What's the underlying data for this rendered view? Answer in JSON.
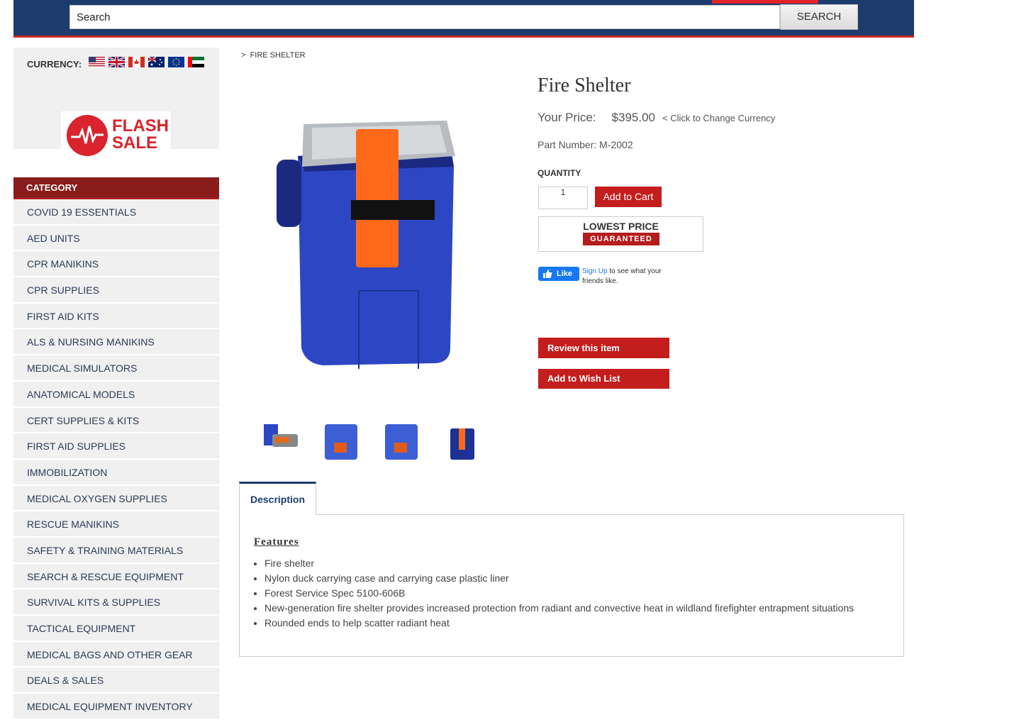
{
  "header": {
    "search_placeholder": "Search",
    "search_button": "SEARCH"
  },
  "sidebar": {
    "currency_label": "CURRENCY:",
    "currencies": [
      "us-flag-icon",
      "uk-flag-icon",
      "canada-flag-icon",
      "australia-flag-icon",
      "eu-flag-icon",
      "uae-flag-icon"
    ],
    "promo": {
      "line1": "FLASH",
      "line2": "SALE"
    },
    "category_title": "CATEGORY",
    "categories": [
      "COVID 19 ESSENTIALS",
      "AED UNITS",
      "CPR MANIKINS",
      "CPR SUPPLIES",
      "FIRST AID KITS",
      "ALS & NURSING MANIKINS",
      "MEDICAL SIMULATORS",
      "ANATOMICAL MODELS",
      "CERT SUPPLIES & KITS",
      "FIRST AID SUPPLIES",
      "IMMOBILIZATION",
      "MEDICAL OXYGEN SUPPLIES",
      "RESCUE MANIKINS",
      "SAFETY & TRAINING MATERIALS",
      "SEARCH & RESCUE EQUIPMENT",
      "SURVIVAL KITS & SUPPLIES",
      "TACTICAL EQUIPMENT",
      "MEDICAL BAGS AND OTHER GEAR",
      "DEALS & SALES",
      "MEDICAL EQUIPMENT INVENTORY"
    ]
  },
  "breadcrumb": {
    "sep": ">",
    "current": "FIRE SHELTER"
  },
  "product": {
    "title": "Fire Shelter",
    "price_label": "Your Price:",
    "price": "$395.00",
    "change_currency": "< Click to Change Currency",
    "part_label": "Part Number:",
    "part_number": "M-2002",
    "quantity_label": "QUANTITY",
    "quantity_value": "1",
    "add_to_cart": "Add to Cart",
    "lowest_price": "LOWEST PRICE",
    "guaranteed": "GUARANTEED",
    "like_label": "Like",
    "like_signup": "Sign Up",
    "like_text": "to see what your friends like.",
    "review_button": "Review this item",
    "wishlist_button": "Add to Wish List"
  },
  "tabs": {
    "description": "Description"
  },
  "description": {
    "heading": "Features",
    "items": [
      "Fire shelter",
      "Nylon duck carrying case and carrying case plastic liner",
      "Forest Service Spec 5100-606B",
      "New-generation fire shelter provides increased protection from radiant and convective heat in wildland firefighter entrapment situations",
      "Rounded ends to help scatter radiant heat"
    ]
  },
  "colors": {
    "navy": "#1d3c6e",
    "red": "#c41d1d",
    "category_bg": "#8a1c1c",
    "sidebar_bg": "#f0f0f0"
  }
}
